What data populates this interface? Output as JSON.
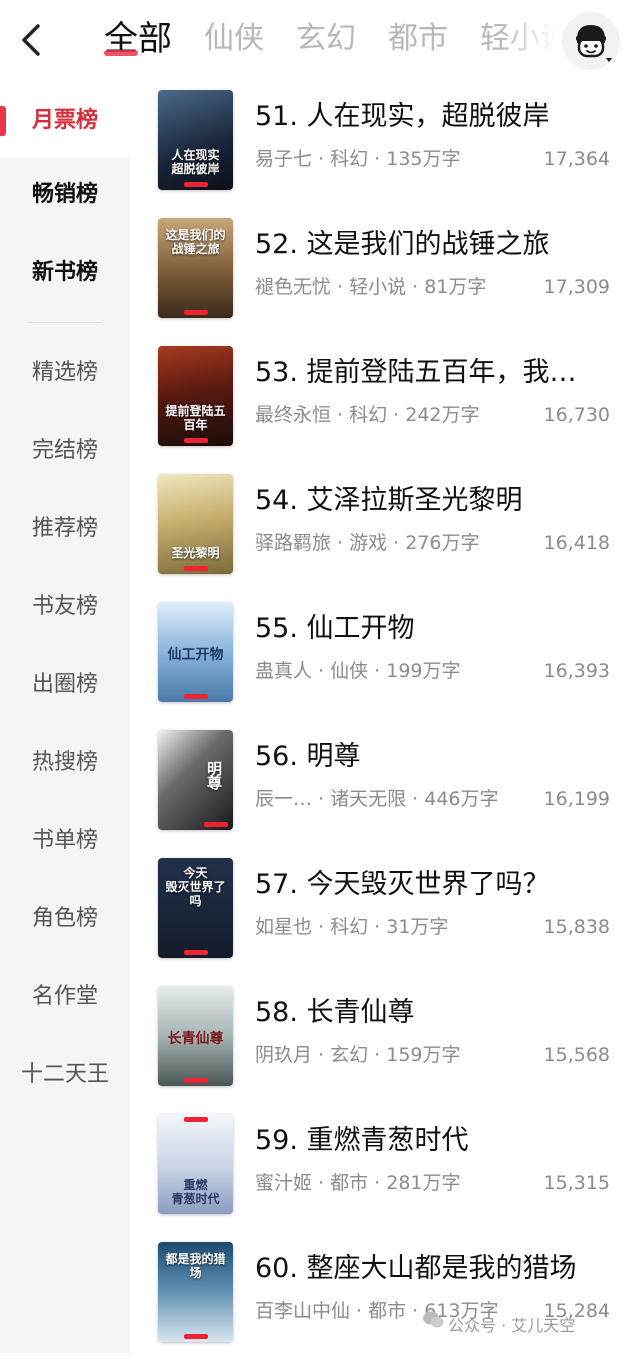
{
  "header": {
    "tabs": [
      "全部",
      "仙侠",
      "玄幻",
      "都市",
      "轻小说"
    ]
  },
  "sidebar": {
    "items": [
      "月票榜",
      "畅销榜",
      "新书榜",
      "精选榜",
      "完结榜",
      "推荐榜",
      "书友榜",
      "出圈榜",
      "热搜榜",
      "书单榜",
      "角色榜",
      "名作堂",
      "十二天王"
    ]
  },
  "books": [
    {
      "rank_title": "51. 人在现实，超脱彼岸",
      "meta": "易子七 · 科幻 · 135万字",
      "votes": "17,364",
      "cover_text": "人在现实\n超脱彼岸",
      "cover_color": "#2a3a52"
    },
    {
      "rank_title": "52. 这是我们的战锤之旅",
      "meta": "褪色无忧 · 轻小说 · 81万字",
      "votes": "17,309",
      "cover_text": "这是我们的\n战锤之旅",
      "cover_color": "#6a5436"
    },
    {
      "rank_title": "53. 提前登陆五百年，我…",
      "meta": "最终永恒 · 科幻 · 242万字",
      "votes": "16,730",
      "cover_text": "提前登陆五百年",
      "cover_color": "#3a1e1a"
    },
    {
      "rank_title": "54. 艾泽拉斯圣光黎明",
      "meta": "驿路羁旅 · 游戏 · 276万字",
      "votes": "16,418",
      "cover_text": "圣光黎明",
      "cover_color": "#a89860"
    },
    {
      "rank_title": "55. 仙工开物",
      "meta": "蛊真人 · 仙侠 · 199万字",
      "votes": "16,393",
      "cover_text": "仙工开物",
      "cover_color": "#6a9ac8"
    },
    {
      "rank_title": "56. 明尊",
      "meta": "辰一…  · 诸天无限 · 446万字",
      "votes": "16,199",
      "cover_text": "明尊",
      "cover_color": "#2a2a2a"
    },
    {
      "rank_title": "57. 今天毁灭世界了吗？",
      "meta": "如星也 · 科幻 · 31万字",
      "votes": "15,838",
      "cover_text": "今天\n毁灭世界了吗",
      "cover_color": "#1c2636"
    },
    {
      "rank_title": "58. 长青仙尊",
      "meta": "阴玖月 · 玄幻 · 159万字",
      "votes": "15,568",
      "cover_text": "长青仙尊",
      "cover_color": "#7a8a8a"
    },
    {
      "rank_title": "59. 重燃青葱时代",
      "meta": "蜜汁姬 · 都市 · 281万字",
      "votes": "15,315",
      "cover_text": "重燃\n青葱时代",
      "cover_color": "#c8d0e0"
    },
    {
      "rank_title": "60. 整座大山都是我的猎场",
      "meta": "百李山中仙 · 都市 · 613万字",
      "votes": "15,284",
      "cover_text": "都是我的猎场",
      "cover_color": "#3a6a90"
    }
  ],
  "watermark": "公众号 · 艾儿天空"
}
